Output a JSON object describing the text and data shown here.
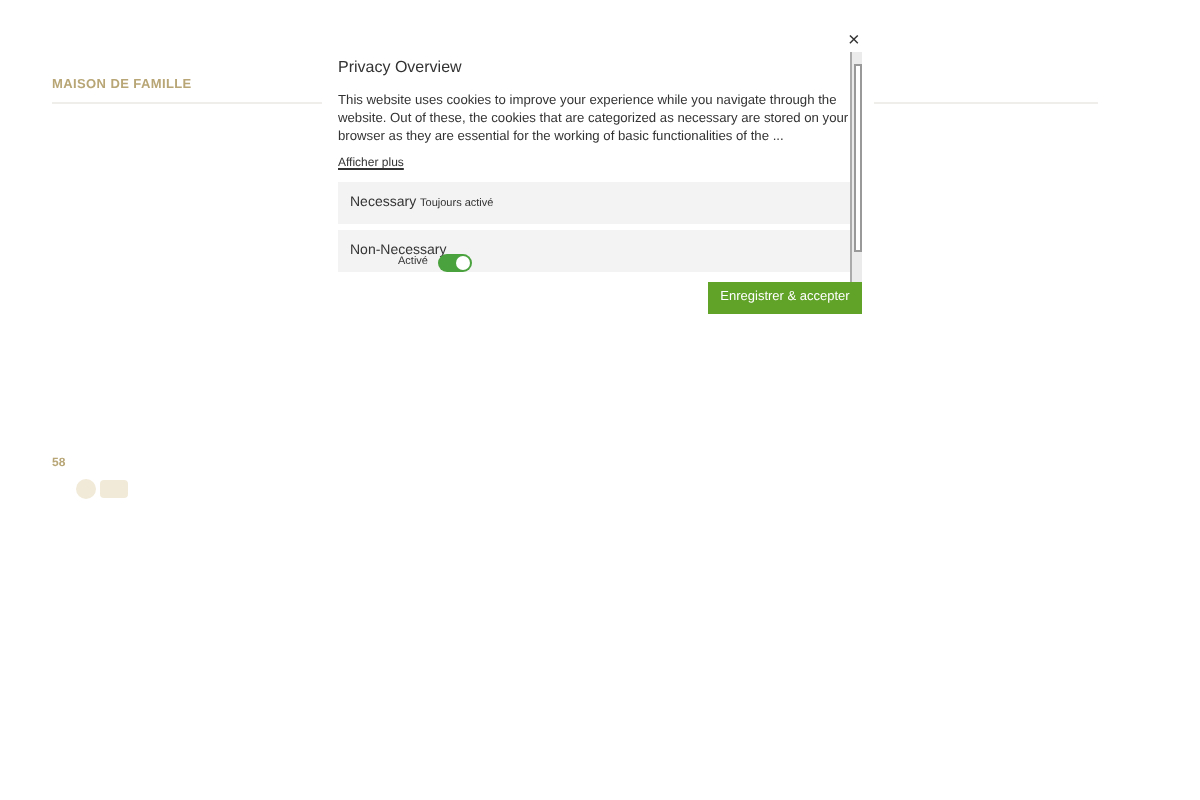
{
  "page": {
    "site_name": "MAISON DE FAMILLE",
    "number": "58"
  },
  "modal": {
    "close": "×",
    "title": "Privacy Overview",
    "text": "This website uses cookies to improve your experience while you navigate through the website. Out of these, the cookies that are categorized as necessary are stored on your browser as they are essential for the working of basic functionalities of the ...",
    "more_link": "Afficher plus",
    "categories": [
      {
        "kind": "always",
        "name": "Necessary",
        "status": "Toujours activé"
      },
      {
        "kind": "toggle",
        "name": "Non-Necessary",
        "status": "Activé",
        "on": true
      }
    ],
    "accept_button": "Enregistrer & accepter"
  }
}
